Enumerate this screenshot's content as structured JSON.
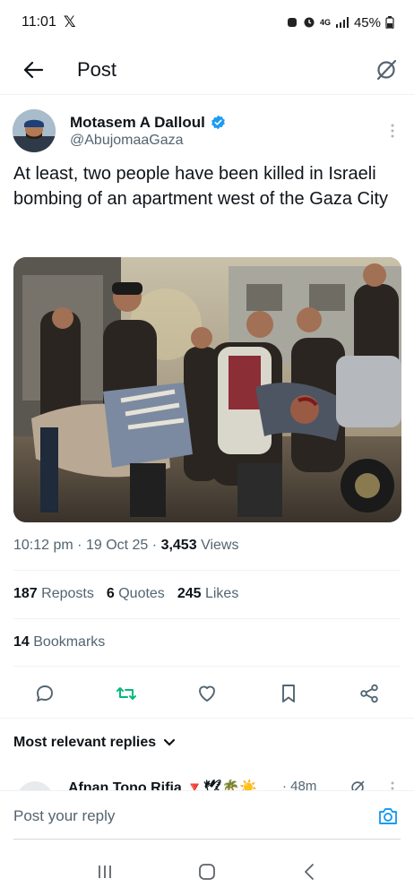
{
  "status_bar": {
    "time": "11:01",
    "x_logo": "𝕏",
    "network": "4G",
    "battery": "45%"
  },
  "header": {
    "title": "Post"
  },
  "author": {
    "name": "Motasem A Dalloul",
    "handle": "@AbujomaaGaza"
  },
  "tweet": {
    "text": "At least, two people have been killed in Israeli bombing of an apartment west of the Gaza City",
    "time": "10:12 pm",
    "date": "19 Oct 25",
    "views_count": "3,453",
    "views_label": "Views"
  },
  "stats": {
    "reposts_count": "187",
    "reposts_label": "Reposts",
    "quotes_count": "6",
    "quotes_label": "Quotes",
    "likes_count": "245",
    "likes_label": "Likes",
    "bookmarks_count": "14",
    "bookmarks_label": "Bookmarks"
  },
  "replies": {
    "sort_label": "Most relevant replies",
    "first_reply_name": "Afnan Tono Rifia 🔻🕊🌴☀️",
    "first_reply_time": "· 48m"
  },
  "reply_box": {
    "placeholder": "Post your reply"
  },
  "colors": {
    "accent_blue": "#1d9bf0",
    "repost_green": "#00ba7c",
    "text_primary": "#0f1419",
    "text_secondary": "#536471"
  }
}
